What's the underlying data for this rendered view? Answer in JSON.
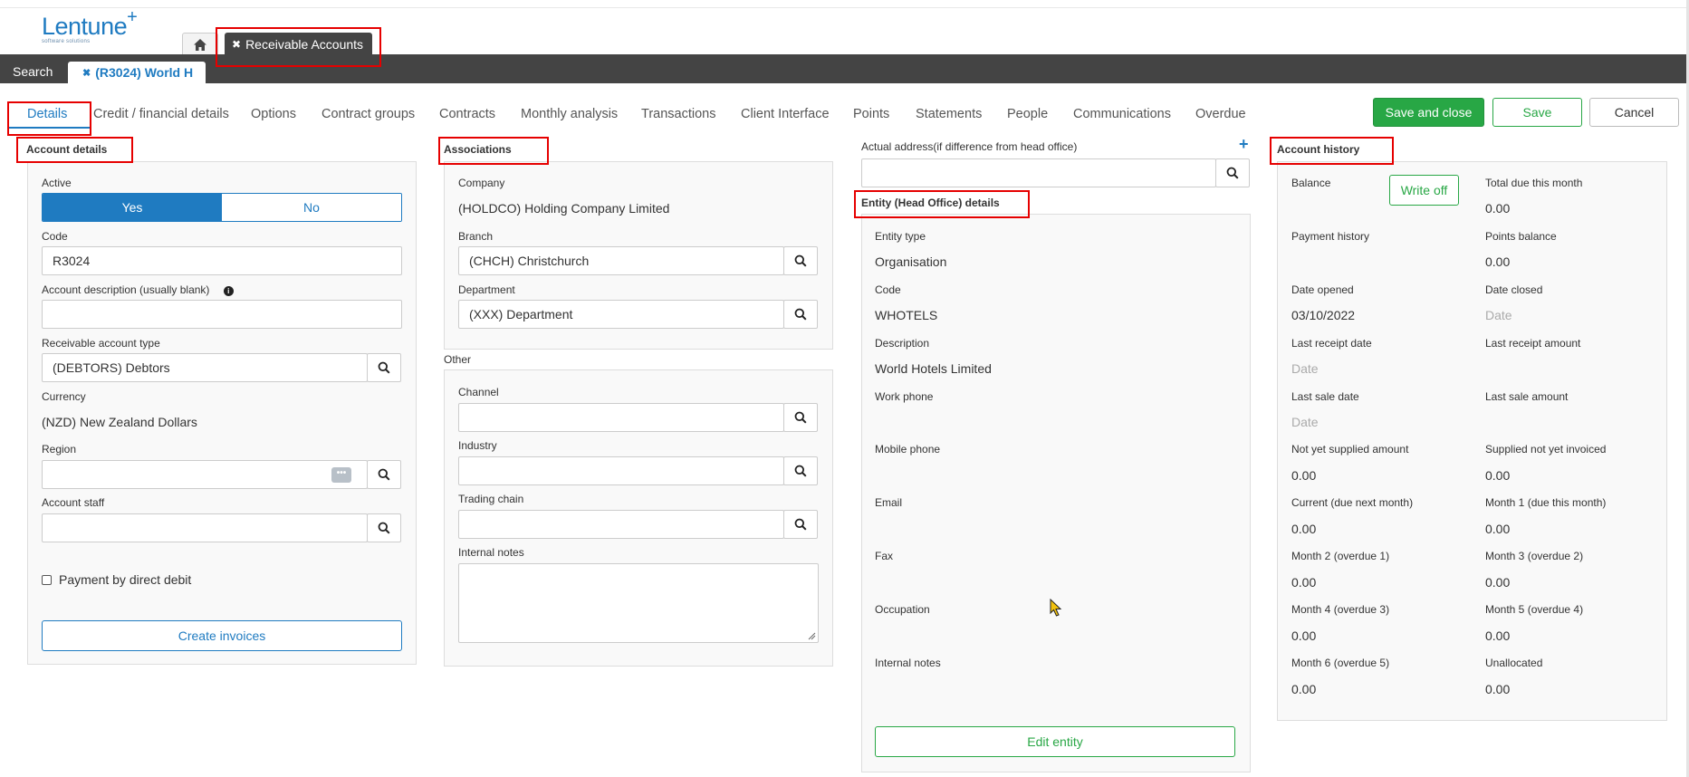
{
  "header": {
    "logo_text": "Lentune",
    "logo_sub": "software solutions",
    "module_tab": "Receivable Accounts",
    "search_tab": "Search",
    "record_tab": "(R3024) World H"
  },
  "tabs": [
    "Details",
    "Credit / financial details",
    "Options",
    "Contract groups",
    "Contracts",
    "Monthly analysis",
    "Transactions",
    "Client Interface",
    "Points",
    "Statements",
    "People",
    "Communications",
    "Overdue"
  ],
  "actions": {
    "save_close": "Save and close",
    "save": "Save",
    "cancel": "Cancel"
  },
  "account_details": {
    "title": "Account details",
    "active_label": "Active",
    "yes": "Yes",
    "no": "No",
    "code_label": "Code",
    "code_value": "R3024",
    "desc_label": "Account description (usually blank)",
    "desc_value": "",
    "type_label": "Receivable account type",
    "type_value": "(DEBTORS) Debtors",
    "currency_label": "Currency",
    "currency_value": "(NZD) New Zealand Dollars",
    "region_label": "Region",
    "staff_label": "Account staff",
    "direct_debit_label": "Payment by direct debit",
    "create_invoices": "Create invoices"
  },
  "associations": {
    "title": "Associations",
    "company_label": "Company",
    "company_value": "(HOLDCO) Holding Company Limited",
    "branch_label": "Branch",
    "branch_value": "(CHCH) Christchurch",
    "dept_label": "Department",
    "dept_value": "(XXX) Department"
  },
  "other": {
    "title": "Other",
    "channel_label": "Channel",
    "industry_label": "Industry",
    "trading_label": "Trading chain",
    "notes_label": "Internal notes"
  },
  "address": {
    "label": "Actual address(if difference from head office)"
  },
  "entity": {
    "title": "Entity (Head Office) details",
    "type_label": "Entity type",
    "type_value": "Organisation",
    "code_label": "Code",
    "code_value": "WHOTELS",
    "desc_label": "Description",
    "desc_value": "World Hotels Limited",
    "work_phone_label": "Work phone",
    "mobile_label": "Mobile phone",
    "email_label": "Email",
    "fax_label": "Fax",
    "occupation_label": "Occupation",
    "notes_label": "Internal notes",
    "edit_button": "Edit entity"
  },
  "history": {
    "title": "Account history",
    "balance_label": "Balance",
    "write_off": "Write off",
    "total_due_label": "Total due this month",
    "total_due_value": "0.00",
    "payment_history_label": "Payment history",
    "points_label": "Points balance",
    "points_value": "0.00",
    "date_opened_label": "Date opened",
    "date_opened_value": "03/10/2022",
    "date_closed_label": "Date closed",
    "date_closed_value": "Date",
    "last_receipt_date_label": "Last receipt date",
    "last_receipt_date_value": "Date",
    "last_receipt_amount_label": "Last receipt amount",
    "last_sale_date_label": "Last sale date",
    "last_sale_date_value": "Date",
    "last_sale_amount_label": "Last sale amount",
    "not_supplied_label": "Not yet supplied amount",
    "not_supplied_value": "0.00",
    "supplied_not_invoiced_label": "Supplied not yet invoiced",
    "supplied_not_invoiced_value": "0.00",
    "current_label": "Current (due next month)",
    "current_value": "0.00",
    "month1_label": "Month 1 (due this month)",
    "month1_value": "0.00",
    "month2_label": "Month 2 (overdue 1)",
    "month2_value": "0.00",
    "month3_label": "Month 3 (overdue 2)",
    "month3_value": "0.00",
    "month4_label": "Month 4 (overdue 3)",
    "month4_value": "0.00",
    "month5_label": "Month 5 (overdue 4)",
    "month5_value": "0.00",
    "month6_label": "Month 6 (overdue 5)",
    "month6_value": "0.00",
    "unallocated_label": "Unallocated",
    "unallocated_value": "0.00"
  },
  "colors": {
    "accent": "#1f7bc1",
    "success": "#28a745",
    "dark_bar": "#444444",
    "highlight": "#e60000"
  }
}
